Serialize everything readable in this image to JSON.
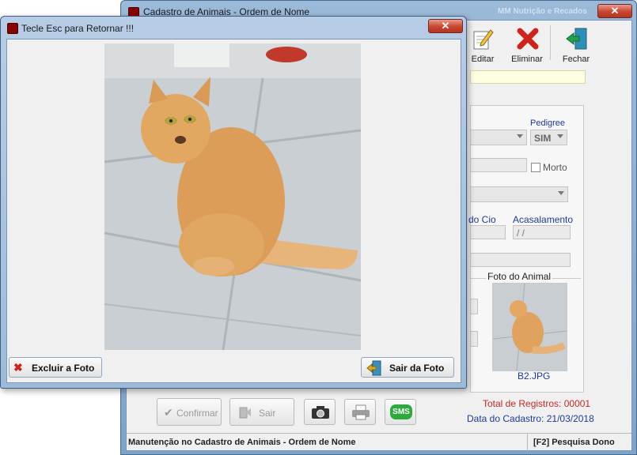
{
  "background_window": {
    "title": "Cadastro de Animais - Ordem de Nome",
    "title_right": "MM Nutrição e Recados",
    "close_label": "✕",
    "toolbar": {
      "editar": "Editar",
      "eliminar": "Eliminar",
      "fechar": "Fechar"
    },
    "form": {
      "pedigree_label": "Pedigree",
      "pedigree_value": "SIM",
      "morto_label": "Morto",
      "cio_label": "do Cio",
      "acasalamento_label": "Acasalamento",
      "acasalamento_value": " / /",
      "foto_label": "Foto do Animal",
      "foto_filename": "B2.JPG"
    },
    "buttons": {
      "confirmar": "Confirmar",
      "sair": "Sair",
      "sms": "SMS"
    },
    "total_registros": "Total de Registros: 00001",
    "data_cadastro": "Data do Cadastro: 21/03/2018",
    "status_left": "Manutenção no Cadastro de Animais - Ordem de Nome",
    "status_right": "[F2] Pesquisa Dono"
  },
  "dialog": {
    "title": "Tecle Esc para Retornar !!!",
    "close_label": "✕",
    "excluir_label": "Excluir a Foto",
    "sair_label": "Sair da Foto"
  },
  "colors": {
    "accent_blue": "#1c3a9c",
    "accent_red": "#c62828",
    "close_red": "#c9452f"
  }
}
